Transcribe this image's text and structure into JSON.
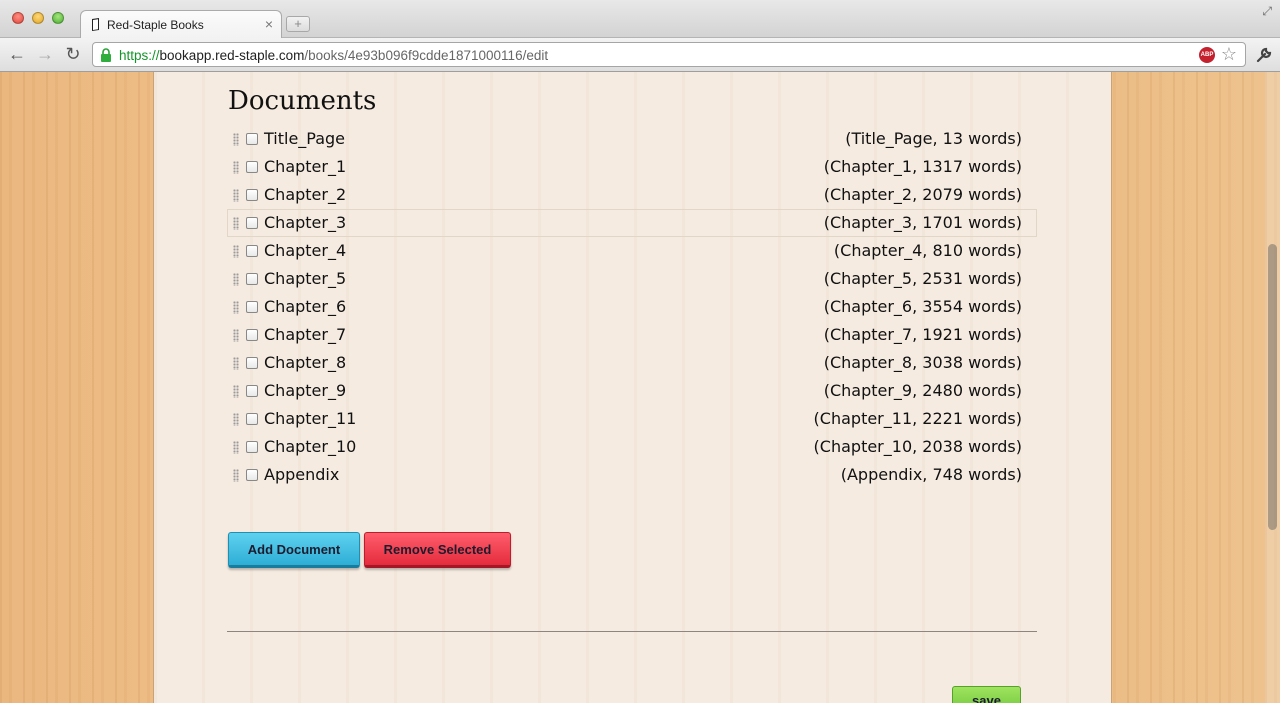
{
  "browser": {
    "tab_title": "Red-Staple Books",
    "tab_close": "×",
    "newtab": "+",
    "url_scheme": "https://",
    "url_host": "bookapp.red-staple.com",
    "url_path": "/books/4e93b096f9cdde1871000116/edit",
    "abp_label": "ABP",
    "icons": {
      "back": "←",
      "forward": "→",
      "reload": "↻",
      "star": "☆",
      "wrench": "🔧",
      "resize": "⤢"
    }
  },
  "page": {
    "heading": "Documents",
    "documents": [
      {
        "name": "Title_Page",
        "meta": "(Title_Page, 13 words)"
      },
      {
        "name": "Chapter_1",
        "meta": "(Chapter_1, 1317 words)"
      },
      {
        "name": "Chapter_2",
        "meta": "(Chapter_2, 2079 words)"
      },
      {
        "name": "Chapter_3",
        "meta": "(Chapter_3, 1701 words)"
      },
      {
        "name": "Chapter_4",
        "meta": "(Chapter_4, 810 words)"
      },
      {
        "name": "Chapter_5",
        "meta": "(Chapter_5, 2531 words)"
      },
      {
        "name": "Chapter_6",
        "meta": "(Chapter_6, 3554 words)"
      },
      {
        "name": "Chapter_7",
        "meta": "(Chapter_7, 1921 words)"
      },
      {
        "name": "Chapter_8",
        "meta": "(Chapter_8, 3038 words)"
      },
      {
        "name": "Chapter_9",
        "meta": "(Chapter_9, 2480 words)"
      },
      {
        "name": "Chapter_11",
        "meta": "(Chapter_11, 2221 words)"
      },
      {
        "name": "Chapter_10",
        "meta": "(Chapter_10, 2038 words)"
      },
      {
        "name": "Appendix",
        "meta": "(Appendix, 748 words)"
      }
    ],
    "add_button": "Add Document",
    "remove_button": "Remove Selected",
    "save_button": "save"
  },
  "colors": {
    "add_button": "#2eaed6",
    "remove_button": "#e52c3d",
    "save_button": "#6cc33a",
    "paper": "#f5ebe1"
  }
}
